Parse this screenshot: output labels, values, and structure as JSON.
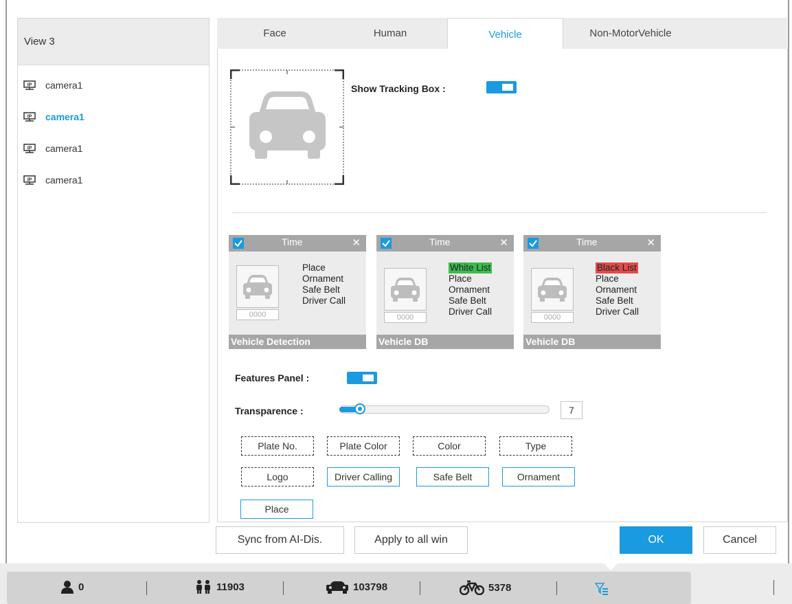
{
  "left_panel": {
    "view_title": "View 3",
    "cameras": [
      {
        "label": "camera1",
        "active": false
      },
      {
        "label": "camera1",
        "active": true
      },
      {
        "label": "camera1",
        "active": false
      },
      {
        "label": "camera1",
        "active": false
      }
    ]
  },
  "tabs": [
    {
      "label": "Face",
      "active": false
    },
    {
      "label": "Human",
      "active": false
    },
    {
      "label": "Vehicle",
      "active": true
    },
    {
      "label": "Non-MotorVehicle",
      "active": false
    }
  ],
  "tracking": {
    "label": "Show Tracking Box :",
    "enabled": true
  },
  "cards": [
    {
      "header": "Time",
      "tag": "",
      "tag_color": "",
      "lines": [
        "Place",
        "Ornament",
        "Safe Belt",
        "Driver Call"
      ],
      "plate": "0000",
      "footer": "Vehicle Detection"
    },
    {
      "header": "Time",
      "tag": "White List",
      "tag_color": "#3dbb4f",
      "lines": [
        "Place",
        "Ornament",
        "Safe Belt",
        "Driver Call"
      ],
      "plate": "0000",
      "footer": "Vehicle DB"
    },
    {
      "header": "Time",
      "tag": "Black List",
      "tag_color": "#e04b4b",
      "lines": [
        "Place",
        "Ornament",
        "Safe Belt",
        "Driver Call"
      ],
      "plate": "0000",
      "footer": "Vehicle DB"
    }
  ],
  "features_panel": {
    "label": "Features Panel :",
    "enabled": true
  },
  "transparence": {
    "label": "Transparence :",
    "value": "7",
    "fraction": 0.1
  },
  "features": [
    {
      "label": "Plate No.",
      "selected": false
    },
    {
      "label": "Plate Color",
      "selected": false
    },
    {
      "label": "Color",
      "selected": false
    },
    {
      "label": "Type",
      "selected": false
    },
    {
      "label": "Logo",
      "selected": false
    },
    {
      "label": "Driver Calling",
      "selected": true
    },
    {
      "label": "Safe Belt",
      "selected": true
    },
    {
      "label": "Ornament",
      "selected": true
    },
    {
      "label": "Place",
      "selected": true
    }
  ],
  "buttons": {
    "sync": "Sync from AI-Dis.",
    "apply_all": "Apply to all win",
    "ok": "OK",
    "cancel": "Cancel"
  },
  "status_bar": {
    "face_count": "0",
    "human_count": "11903",
    "vehicle_count": "103798",
    "bike_count": "5378"
  },
  "colors": {
    "accent": "#1a9ae0",
    "panel_gray": "#ececec",
    "card_header": "#a6a6a6"
  }
}
